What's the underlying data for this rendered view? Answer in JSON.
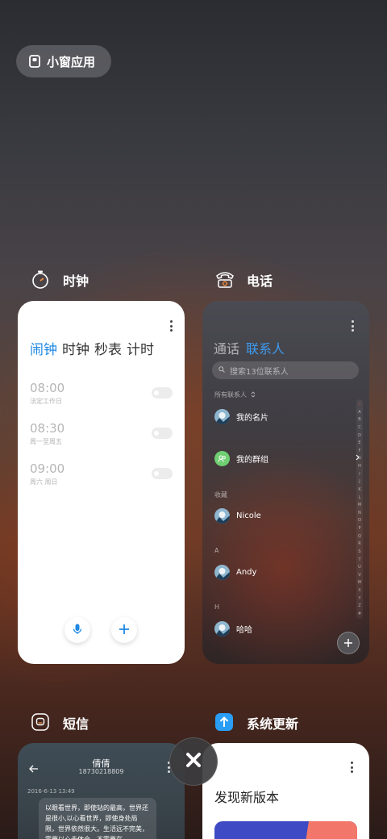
{
  "floating": {
    "label": "小窗应用",
    "icon": "floating-window-icon"
  },
  "apps": {
    "clock": {
      "name": "时钟",
      "icon": "stopwatch-icon",
      "tabs": [
        "闹钟",
        "时钟",
        "秒表",
        "计时"
      ],
      "active_tab": 0,
      "alarms": [
        {
          "time": "08:00",
          "repeat": "法定工作日",
          "enabled": false
        },
        {
          "time": "08:30",
          "repeat": "周一至周五",
          "enabled": false
        },
        {
          "time": "09:00",
          "repeat": "周六 周日",
          "enabled": false
        }
      ],
      "buttons": {
        "voice": "microphone-icon",
        "add": "plus-icon"
      }
    },
    "phone": {
      "name": "电话",
      "icon": "telephone-icon",
      "tabs": [
        "通话",
        "联系人"
      ],
      "active_tab": 1,
      "search_placeholder": "搜索13位联系人",
      "all_contacts": "所有联系人",
      "my_card": "我的名片",
      "my_groups": "我的群组",
      "favorites_label": "收藏",
      "favorite_contact": "Nicole",
      "section_a": "A",
      "contact_a": "Andy",
      "section_h": "H",
      "contact_h": "哈哈",
      "index_letters": [
        "☆",
        "A",
        "B",
        "C",
        "D",
        "E",
        "F",
        "G",
        "H",
        "I",
        "J",
        "K",
        "L",
        "M",
        "N",
        "O",
        "P",
        "Q",
        "R",
        "S",
        "T",
        "U",
        "V",
        "W",
        "X",
        "Y",
        "Z",
        "#"
      ]
    },
    "sms": {
      "name": "短信",
      "icon": "message-icon",
      "contact_name": "倩倩",
      "contact_number": "18730218809",
      "date": "2016-6-13 13:49",
      "message": "以眼看世界，即使站的最高，世界还是很小,以心看世界，即使身处局限，世界依然很大。生活远不完美，需要以心去体会，不需要在..."
    },
    "update": {
      "name": "系统更新",
      "icon": "system-update-icon",
      "headline": "发现新版本"
    }
  },
  "colors": {
    "accent_blue": "#1e88e5",
    "contacts_blue": "#3d9bf0",
    "group_green": "#6fcf72",
    "update_blue": "#3d4ac4",
    "update_coral": "#f2766a"
  },
  "close_button": "close-icon"
}
